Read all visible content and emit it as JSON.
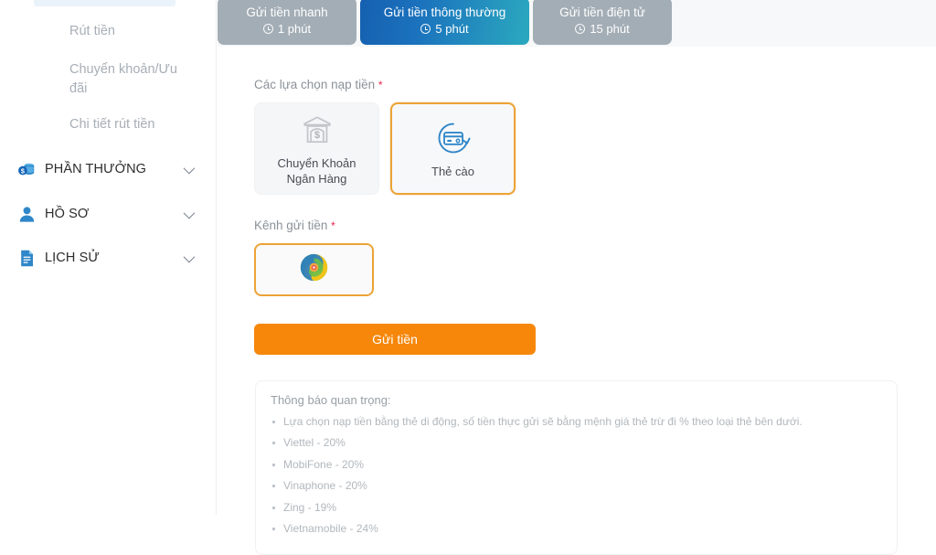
{
  "colors": {
    "accent_orange": "#f6870b",
    "select_border": "#eca336",
    "tab_active_from": "#1560b0",
    "tab_active_to": "#2ba9bf",
    "tab_inactive": "#a3adb5",
    "required_star": "#ec1f4b",
    "icon_blue": "#2f86c8"
  },
  "sidebar": {
    "sublinks": [
      {
        "label": "Rút tiền"
      },
      {
        "label": "Chuyển khoản/Ưu đãi"
      },
      {
        "label": "Chi tiết rút tiền"
      }
    ],
    "groups": [
      {
        "label": "PHẦN THƯỞNG",
        "icon": "coins-icon",
        "chevron": "chevron-down-icon"
      },
      {
        "label": "HỒ SƠ",
        "icon": "user-icon",
        "chevron": "chevron-down-icon"
      },
      {
        "label": "LỊCH SỬ",
        "icon": "document-icon",
        "chevron": "chevron-down-icon"
      }
    ]
  },
  "tabs": [
    {
      "label": "Gửi tiền nhanh",
      "duration": "1 phút",
      "active": false,
      "icon": "clock-icon"
    },
    {
      "label": "Gửi tiền thông thường",
      "duration": "5 phút",
      "active": true,
      "icon": "clock-icon"
    },
    {
      "label": "Gửi tiền điện tử",
      "duration": "15 phút",
      "active": false,
      "icon": "clock-icon"
    }
  ],
  "form": {
    "deposit_options_label": "Các lựa chọn nạp tiền",
    "deposit_options_required": "*",
    "deposit_options": [
      {
        "label": "Chuyển Khoản Ngân Hàng",
        "icon": "bank-icon",
        "selected": false
      },
      {
        "label": "Thẻ cào",
        "icon": "card-refresh-icon",
        "selected": true
      }
    ],
    "channel_label": "Kênh gửi tiền",
    "channel_required": "*",
    "channels": [
      {
        "icon": "swirl-logo-icon",
        "selected": true
      }
    ],
    "submit_label": "Gửi tiền"
  },
  "notice": {
    "title": "Thông báo quan trọng:",
    "items": [
      "Lựa chọn nạp tiền bằng thẻ di động, số tiền thực gửi sẽ bằng mệnh giá thẻ trừ đi % theo loại thẻ bên dưới.",
      "Viettel - 20%",
      "MobiFone - 20%",
      "Vinaphone - 20%",
      "Zing - 19%",
      "Vietnamobile - 24%"
    ]
  }
}
